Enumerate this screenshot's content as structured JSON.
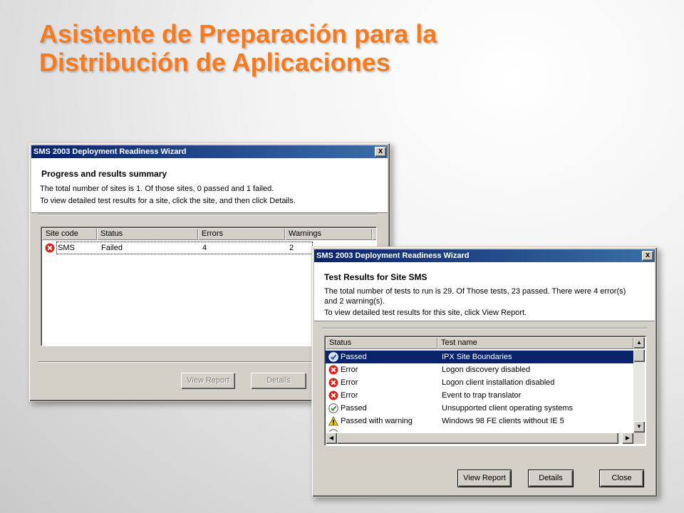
{
  "slide": {
    "title_line1": "Asistente de Preparación para la",
    "title_line2": "Distribución de Aplicaciones",
    "title_color": "#f47b20"
  },
  "window1": {
    "title": "SMS 2003 Deployment Readiness Wizard",
    "close_glyph": "x",
    "header_title": "Progress and results summary",
    "summary_line1": "The total number of sites is 1. Of those sites, 0 passed and 1 failed.",
    "summary_line2": "To view detailed test results for a site, click the site, and then click Details.",
    "columns": [
      "Site code",
      "Status",
      "Errors",
      "Warnings"
    ],
    "rows": [
      {
        "icon": "error-icon",
        "site_code": "SMS",
        "status": "Failed",
        "errors": "4",
        "warnings": "2"
      }
    ],
    "buttons": {
      "view_report": "View Report",
      "details": "Details"
    }
  },
  "window2": {
    "title": "SMS 2003 Deployment Readiness Wizard",
    "close_glyph": "x",
    "header_title": "Test Results for Site SMS",
    "summary_line1": "The total number of tests to run is 29. Of Those tests, 23 passed. There were 4 error(s)",
    "summary_line2": "and 2 warning(s).",
    "summary_line3": "To view detailed test results for this site, click View Report.",
    "columns": [
      "Status",
      "Test name"
    ],
    "rows": [
      {
        "icon": "passed-info-icon",
        "status": "Passed",
        "test_name": "IPX Site Boundaries",
        "selected": true
      },
      {
        "icon": "error-icon",
        "status": "Error",
        "test_name": "Logon discovery disabled"
      },
      {
        "icon": "error-icon",
        "status": "Error",
        "test_name": "Logon client installation disabled"
      },
      {
        "icon": "error-icon",
        "status": "Error",
        "test_name": "Event to trap translator"
      },
      {
        "icon": "check-icon",
        "status": "Passed",
        "test_name": "Unsupported client operating systems"
      },
      {
        "icon": "warning-icon",
        "status": "Passed with warning",
        "test_name": "Windows 98 FE clients without IE 5"
      }
    ],
    "buttons": {
      "view_report": "View Report",
      "details": "Details",
      "close": "Close"
    }
  },
  "colors": {
    "titlebar_start": "#0a246a",
    "titlebar_end": "#3a6ea5",
    "selection": "#0a246a",
    "error": "#d9251d",
    "warning": "#f2c500",
    "check": "#2e8b2e"
  }
}
